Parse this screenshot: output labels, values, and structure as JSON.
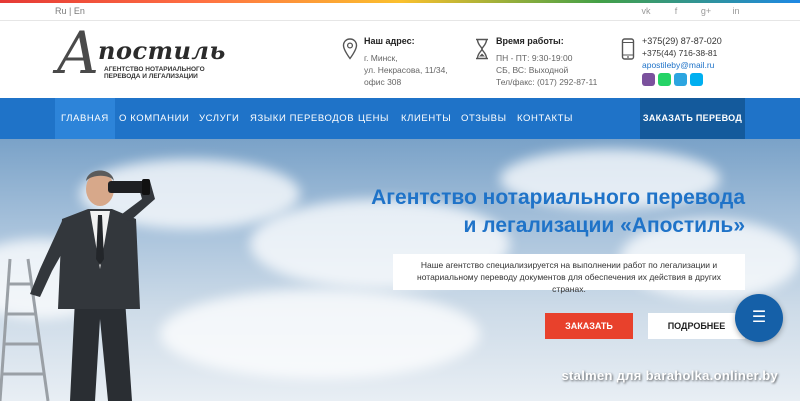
{
  "topbar": {
    "lang_ru": "Ru",
    "lang_sep": "|",
    "lang_en": "En",
    "socials": [
      {
        "name": "vk-icon",
        "glyph": "vk"
      },
      {
        "name": "facebook-icon",
        "glyph": "f"
      },
      {
        "name": "google-plus-icon",
        "glyph": "g+"
      },
      {
        "name": "linkedin-icon",
        "glyph": "in"
      }
    ]
  },
  "logo": {
    "big_letter": "А",
    "word": "постиль",
    "subtitle": "Агентство нотариального перевода и легализации"
  },
  "address": {
    "title": "Наш адрес:",
    "lines": [
      "г. Минск,",
      "ул. Некрасова, 11/34,",
      "офис 308"
    ]
  },
  "hours": {
    "title": "Время работы:",
    "lines": [
      "ПН - ПТ: 9:30-19:00",
      "СБ, ВС: Выходной",
      "Тел/факс: (017) 292-87-11"
    ]
  },
  "contacts": {
    "phone1": "+375(29) 87-87-020",
    "phone2": "+375(44) 716-38-81",
    "email": "apostileby@mail.ru",
    "messengers": [
      {
        "name": "viber-icon",
        "color": "#7b519d"
      },
      {
        "name": "whatsapp-icon",
        "color": "#25d366"
      },
      {
        "name": "telegram-icon",
        "color": "#2ca5e0"
      },
      {
        "name": "skype-icon",
        "color": "#00aff0"
      }
    ]
  },
  "nav": {
    "items": [
      "ГЛАВНАЯ",
      "О КОМПАНИИ",
      "УСЛУГИ",
      "ЯЗЫКИ ПЕРЕВОДОВ",
      "ЦЕНЫ",
      "КЛИЕНТЫ",
      "ОТЗЫВЫ",
      "КОНТАКТЫ"
    ],
    "active": "ГЛАВНАЯ",
    "order_button": "ЗАКАЗАТЬ ПЕРЕВОД"
  },
  "hero": {
    "title_line1": "Агентство нотариального перевода",
    "title_line2": "и легализации «Апостиль»",
    "description": "Наше агентство специализируется на выполнении работ по легализации и нотариальному переводу документов для обеспечения их действия в других странах.",
    "order_button": "ЗАКАЗАТЬ",
    "more_button": "ПОДРОБНЕЕ",
    "watermark": "stalmen для baraholka.onliner.by"
  },
  "colors": {
    "primary": "#1f73c8",
    "nav_dark": "#145a9c",
    "accent_red": "#e8412c"
  }
}
